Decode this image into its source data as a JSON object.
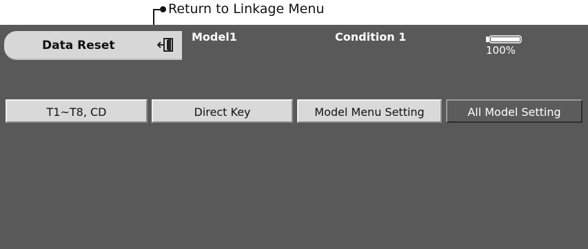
{
  "annotation": {
    "text": "Return to Linkage Menu"
  },
  "header": {
    "title": "Data Reset",
    "model_name": "Model1",
    "condition": "Condition 1",
    "battery_percent": "100%",
    "battery_level": 1.0
  },
  "tabs": [
    {
      "label": "T1~T8, CD"
    },
    {
      "label": "Direct Key"
    },
    {
      "label": "Model Menu Setting"
    },
    {
      "label": "All Model Setting"
    }
  ],
  "colors": {
    "screen_bg": "#595959",
    "button_bg": "#d9d9d9",
    "active_button_bg": "#5c5c5c",
    "text_light": "#ffffff"
  },
  "icons": {
    "return": "return-icon",
    "battery": "battery-icon"
  }
}
